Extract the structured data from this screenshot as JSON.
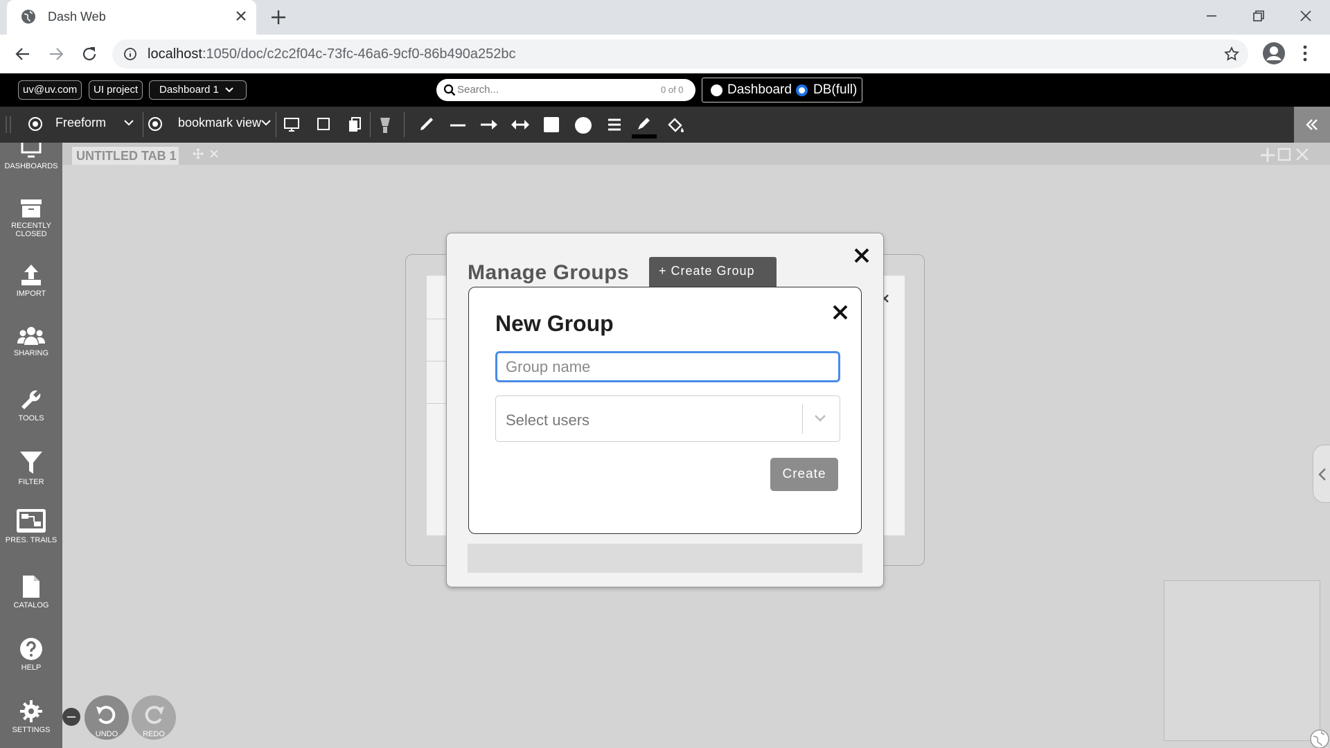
{
  "browser": {
    "tab_title": "Dash Web",
    "url_host": "localhost",
    "url_rest": ":1050/doc/c2c2f04c-73fc-46a6-9cf0-86b490a252bc"
  },
  "appbar": {
    "user": "uv@uv.com",
    "project": "UI project",
    "dashboard": "Dashboard 1",
    "search_placeholder": "Search...",
    "search_count": "0 of 0",
    "mode_dashboard": "Dashboard",
    "mode_db": "DB(full)"
  },
  "toolbar": {
    "layout": "Freeform",
    "view": "bookmark view"
  },
  "sidebar": {
    "items": [
      {
        "label": "DASHBOARDS",
        "icon": "monitor-icon"
      },
      {
        "label": "RECENTLY CLOSED",
        "icon": "archive-icon"
      },
      {
        "label": "IMPORT",
        "icon": "upload-icon"
      },
      {
        "label": "SHARING",
        "icon": "users-icon"
      },
      {
        "label": "TOOLS",
        "icon": "wrench-icon"
      },
      {
        "label": "FILTER",
        "icon": "filter-icon"
      },
      {
        "label": "PRES. TRAILS",
        "icon": "trails-icon"
      },
      {
        "label": "CATALOG",
        "icon": "file-icon"
      },
      {
        "label": "HELP",
        "icon": "help-icon"
      },
      {
        "label": "SETTINGS",
        "icon": "gear-icon"
      }
    ]
  },
  "workspace": {
    "tab_label": "UNTITLED TAB 1"
  },
  "manage_groups": {
    "title": "Manage Groups",
    "create_button": "+ Create Group"
  },
  "new_group": {
    "title": "New Group",
    "name_placeholder": "Group name",
    "select_placeholder": "Select users",
    "create_button": "Create"
  },
  "history": {
    "undo": "UNDO",
    "redo": "REDO"
  },
  "colors": {
    "accent": "#1a73e8",
    "focus_border": "#4a8be8",
    "topbar": "#000000",
    "toolbar": "#323232",
    "sidebar": "#6b6b6b"
  }
}
